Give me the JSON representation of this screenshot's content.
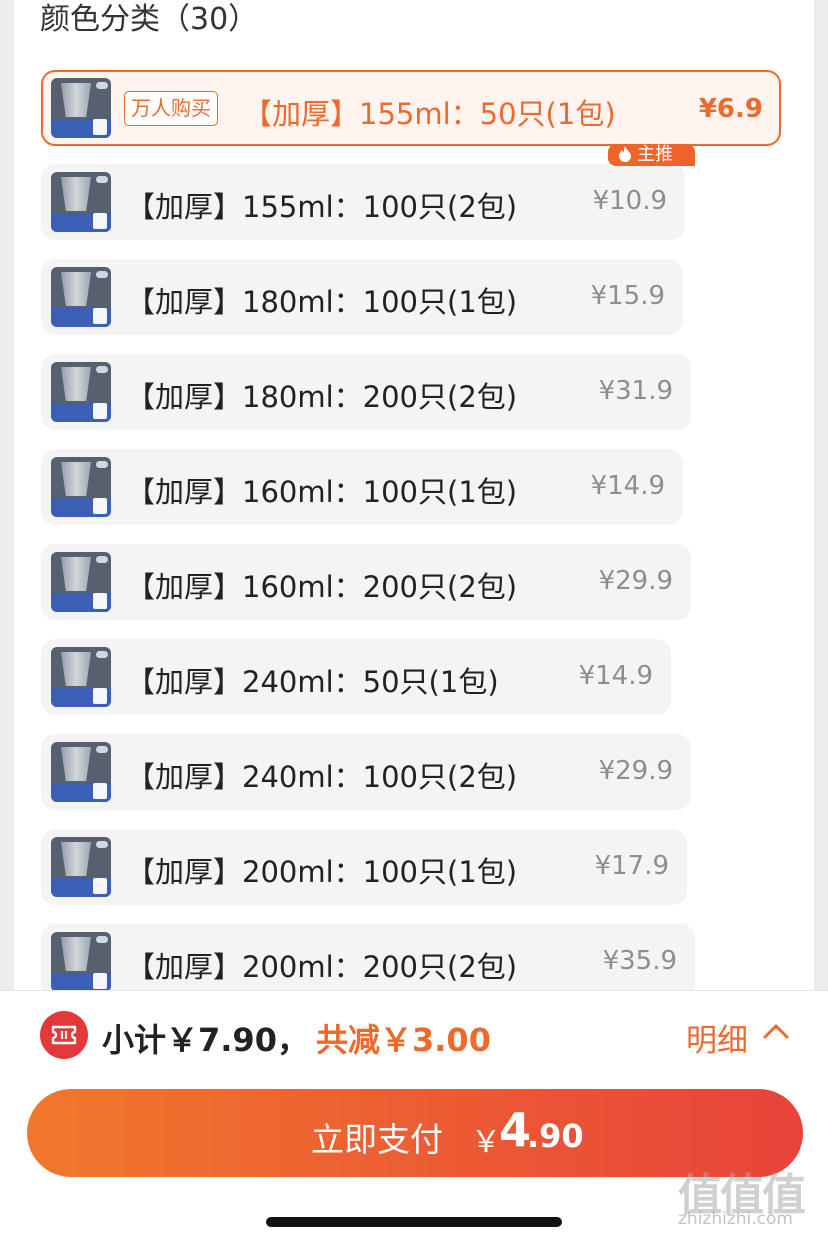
{
  "section": {
    "title": "颜色分类（30）"
  },
  "options": [
    {
      "label": "【加厚】155ml：50只(1包)",
      "price": "¥6.9",
      "selected": true,
      "badge": "万人购买",
      "tag": "主推"
    },
    {
      "label": "【加厚】155ml：100只(2包)",
      "price": "¥10.9"
    },
    {
      "label": "【加厚】180ml：100只(1包)",
      "price": "¥15.9"
    },
    {
      "label": "【加厚】180ml：200只(2包)",
      "price": "¥31.9"
    },
    {
      "label": "【加厚】160ml：100只(1包)",
      "price": "¥14.9"
    },
    {
      "label": "【加厚】160ml：200只(2包)",
      "price": "¥29.9"
    },
    {
      "label": "【加厚】240ml：50只(1包)",
      "price": "¥14.9"
    },
    {
      "label": "【加厚】240ml：100只(2包)",
      "price": "¥29.9"
    },
    {
      "label": "【加厚】200ml：100只(1包)",
      "price": "¥17.9"
    },
    {
      "label": "【加厚】200ml：200只(2包)",
      "price": "¥35.9"
    }
  ],
  "footer": {
    "subtotal": "小计￥7.90，",
    "discount": "共减￥3.00",
    "detail": "明细",
    "pay_label": "立即支付",
    "pay_currency": "￥",
    "pay_integer": "4",
    "pay_decimal": ".90"
  },
  "watermark": {
    "main": "值值值",
    "sub": "zhizhizhi.com"
  },
  "colors": {
    "accent": "#ee6a2c",
    "button_start": "#f0782c",
    "button_end": "#e8433a",
    "coupon": "#e5383b"
  },
  "icons": {
    "coupon": "coupon-ticket-icon",
    "flame": "flame-icon",
    "chevron": "chevron-up-icon"
  }
}
